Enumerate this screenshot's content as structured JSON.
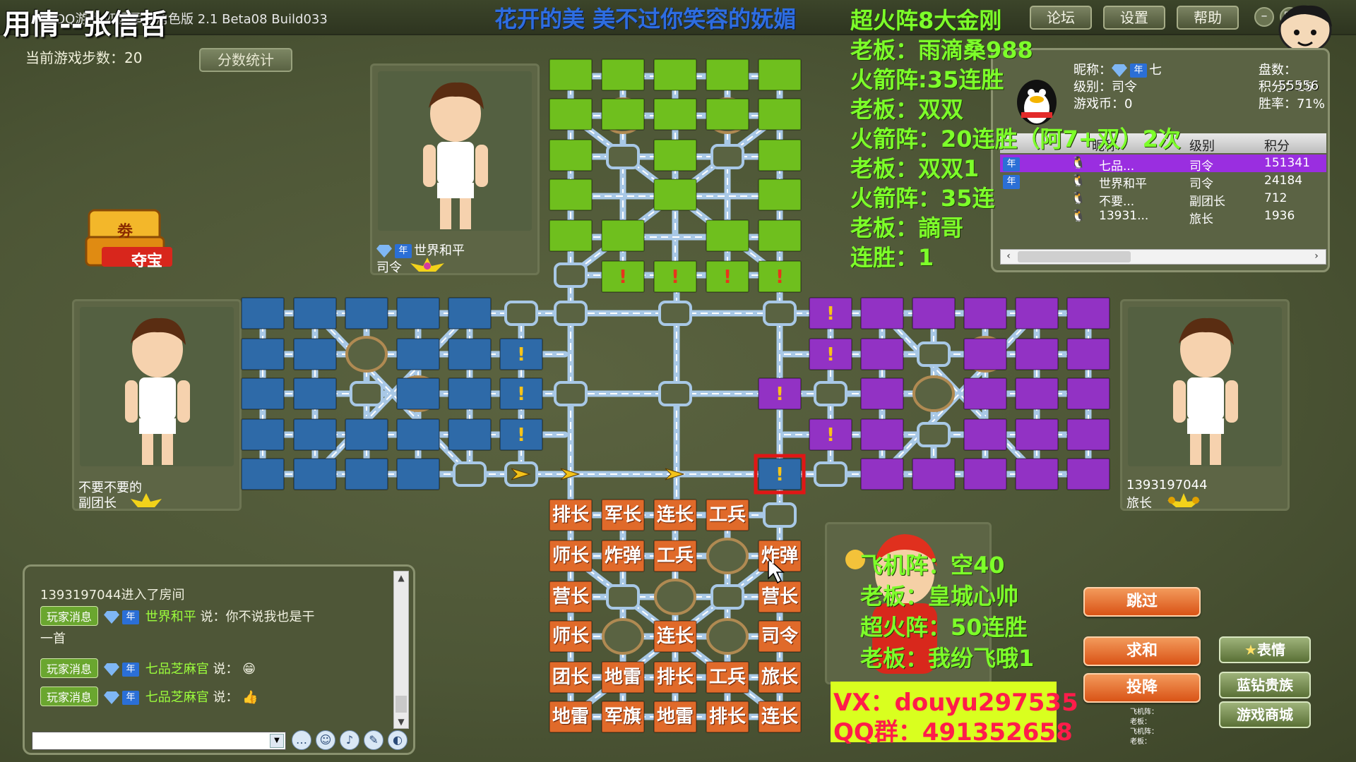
{
  "window": {
    "streamer_name": "用情--张信哲",
    "title": "QQ游戏 四国军棋角色版 2.1 Beta08 Build033",
    "marquee": "花开的美 美不过你笑容的妩媚",
    "buttons": [
      "论坛",
      "设置",
      "帮助"
    ]
  },
  "game": {
    "steps_label": "当前游戏步数：20",
    "stats_button": "分数统计",
    "treasure_label": "夺宝",
    "treasure_badge": "劵"
  },
  "players": {
    "top": {
      "name": "世界和平",
      "rank": "司令",
      "vip": "年"
    },
    "left": {
      "name": "不要不要的",
      "rank": "副团长"
    },
    "right": {
      "name": "1393197044",
      "rank": "旅长"
    }
  },
  "info_panel": {
    "nickname_label": "昵称：",
    "nickname": "七",
    "level_label": "级别：司令",
    "coins_label": "游戏币：0",
    "games_label": "盘数：",
    "score_label": "积分：15",
    "winrate_label": "胜率：71%",
    "overlay_number": "55556",
    "table_headers": [
      "昵称",
      "级别",
      "积分"
    ],
    "rows": [
      {
        "name": "七品...",
        "rank": "司令",
        "score": "151341"
      },
      {
        "name": "世界和平",
        "rank": "司令",
        "score": "24184"
      },
      {
        "name": "不要...",
        "rank": "副团长",
        "score": "712"
      },
      {
        "name": "13931...",
        "rank": "旅长",
        "score": "1936"
      }
    ]
  },
  "overlay_top": [
    "超火阵8大金刚",
    "老板：雨滴桑988",
    "火箭阵:35连胜",
    "老板：双双",
    "火箭阵：20连胜（阿7+双）2次",
    "老板：双双1",
    "火箭阵：35连",
    "老板：謫哥",
    "连胜：1"
  ],
  "overlay_bottom": [
    "飞机阵：空40",
    "老板：皇城心帅",
    "超火阵：50连胜",
    "老板：我纷飞哦1"
  ],
  "contact": {
    "vx": "VX：douyu297535",
    "qq": "QQ群：491352658"
  },
  "actions": {
    "skip": "跳过",
    "draw": "求和",
    "surrender": "投降",
    "emoji": "表情",
    "blue_diamond": "蓝钻贵族",
    "shop": "游戏商城",
    "notes": [
      "飞机阵：",
      "老板：",
      "飞机阵：",
      "老板："
    ]
  },
  "chat": {
    "messages": [
      {
        "type": "system",
        "text": "1393197044进入了房间"
      },
      {
        "type": "player",
        "badge": "玩家消息",
        "vip": "年",
        "name": "世界和平",
        "text": "说：你不说我也是干"
      },
      {
        "type": "cont",
        "text": "一首"
      },
      {
        "type": "player",
        "badge": "玩家消息",
        "vip": "年",
        "name": "七品芝麻官",
        "text": "说：",
        "emoji": "😁"
      },
      {
        "type": "player",
        "badge": "玩家消息",
        "vip": "年",
        "name": "七品芝麻官",
        "text": "说：",
        "emoji": "👍"
      }
    ]
  },
  "board": {
    "my_pieces": [
      [
        "排长",
        "军长",
        "连长",
        "工兵",
        ""
      ],
      [
        "师长",
        "炸弹",
        "工兵",
        "",
        "炸弹"
      ],
      [
        "营长",
        "",
        "",
        "",
        "营长"
      ],
      [
        "师长",
        "",
        "连长",
        "",
        "司令"
      ],
      [
        "团长",
        "地雷",
        "排长",
        "工兵",
        "旅长"
      ],
      [
        "地雷",
        "军旗",
        "地雷",
        "排长",
        "连长"
      ]
    ],
    "colors": {
      "green": "#6fbf1e",
      "blue": "#2e6aa8",
      "purple": "#9232c4",
      "orange": "#e06a2a",
      "road": "#a8c8e6"
    }
  }
}
